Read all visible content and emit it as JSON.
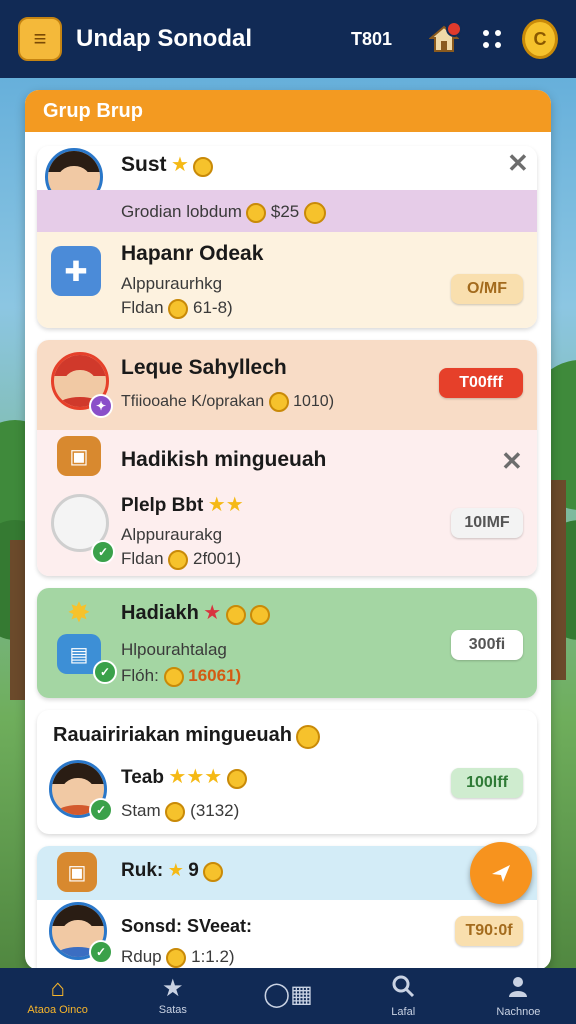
{
  "app": {
    "title": "Undap Sonodal",
    "count": "T801"
  },
  "icons": {
    "logo": "coin-stack-icon",
    "home": "house-icon",
    "menu": "dots-icon",
    "coin": "coin-icon"
  },
  "panel": {
    "title": "Grup Brup"
  },
  "groups": [
    {
      "title": "Sust",
      "banner": "Grodian lobdum",
      "banner_value": "$25",
      "item_title": "Hapanr Odeak",
      "item_sub": "Alppuraurhkg",
      "item_meta": "Fldan",
      "item_meta_value": "61-8)",
      "pill": "O/MF"
    },
    {
      "title": "Leque Sahyllech",
      "sub": "Tfiiooahe K/oprakan",
      "sub_value": "1010)",
      "pill": "T00fff"
    },
    {
      "title": "Hadikish mingueuah",
      "item_title": "Plelp Bbt",
      "item_sub": "Alppuraurakg",
      "item_meta": "Fldan",
      "item_meta_value": "2f001)",
      "pill": "10IMF"
    },
    {
      "title": "Hadiakh",
      "item_sub": "Hlpourahtalag",
      "item_meta": "Flóh:",
      "item_meta_value": "16061)",
      "pill": "300fi"
    },
    {
      "title": "Rauaiririakan mingueuah",
      "item_title": "Teab",
      "item_meta": "Stam",
      "item_meta_value": "(3132)",
      "pill": "100lff"
    },
    {
      "title": "Ruk:",
      "stars": "9",
      "item_title": "Sonsd: SVeeat:",
      "item_meta": "Rdup",
      "item_meta_value": "1:1.2)",
      "pill": "T90:0f"
    }
  ],
  "nav": [
    {
      "label": "Ataoa Oinco",
      "icon": "home-icon"
    },
    {
      "label": "Satas",
      "icon": "star-icon"
    },
    {
      "label": "",
      "icon": "grid-icon"
    },
    {
      "label": "Lafal",
      "icon": "search-icon"
    },
    {
      "label": "Nachnoe",
      "icon": "profile-icon"
    }
  ],
  "colors": {
    "accent": "#f39a21",
    "topbar": "#112a55",
    "red_pill": "#e6402a",
    "green_card": "#a4d6a3"
  }
}
